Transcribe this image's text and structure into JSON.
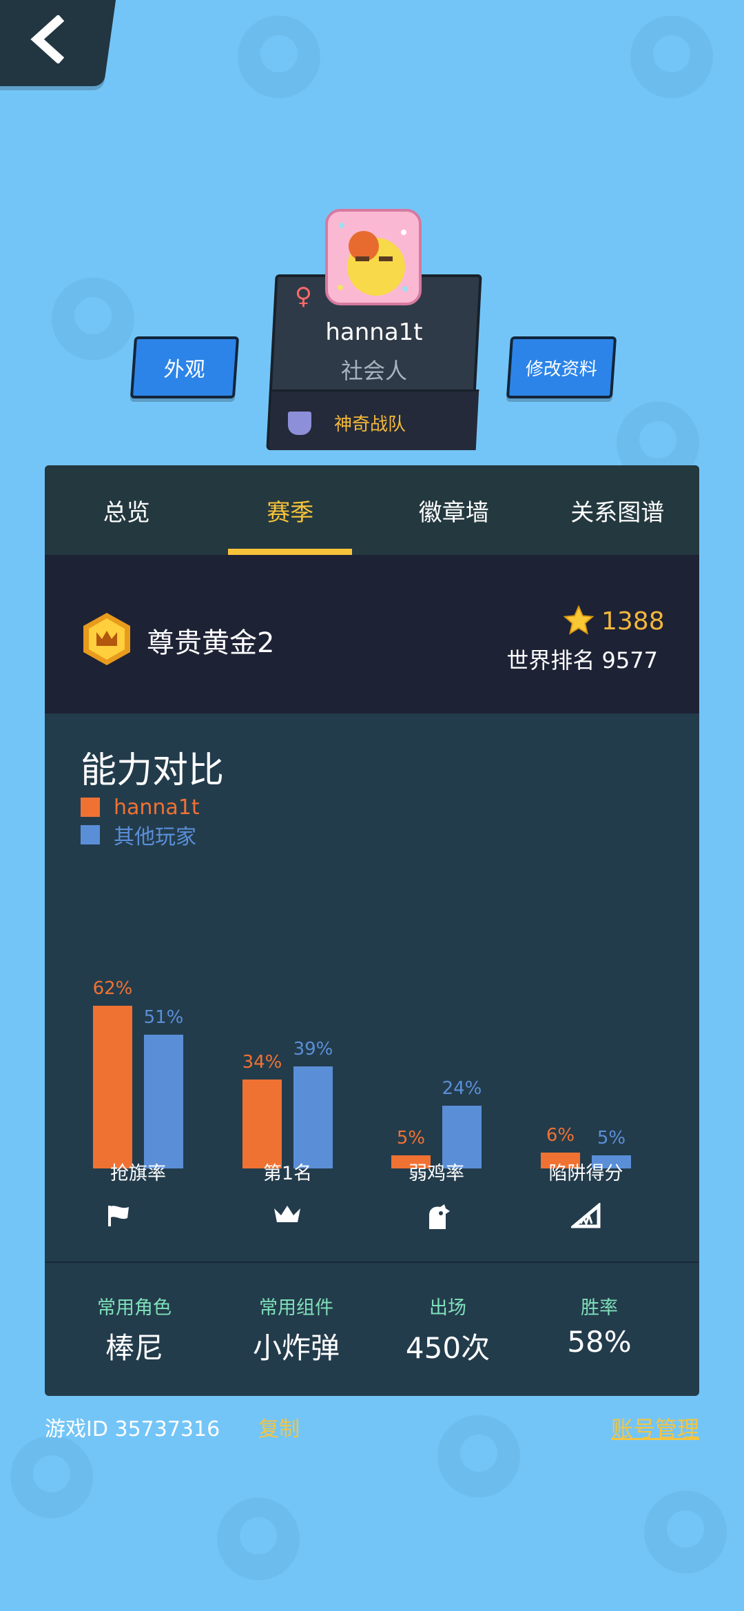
{
  "profile": {
    "gender_symbol": "♀",
    "username": "hanna1t",
    "title": "社会人",
    "team": "神奇战队"
  },
  "buttons": {
    "appearance": "外观",
    "edit_profile": "修改资料"
  },
  "tabs": [
    {
      "label": "总览"
    },
    {
      "label": "赛季",
      "active": true
    },
    {
      "label": "徽章墙"
    },
    {
      "label": "关系图谱"
    }
  ],
  "rank": {
    "tier": "尊贵黄金2",
    "stars": "1388",
    "world_rank": "世界排名 9577"
  },
  "ability": {
    "title": "能力对比",
    "legend_player": "hanna1t",
    "legend_others": "其他玩家"
  },
  "colors": {
    "player": "#f07233",
    "others": "#5a8fd8",
    "accent": "#f7c339",
    "panel": "#233c4c"
  },
  "chart_data": {
    "type": "bar",
    "categories": [
      "抢旗率",
      "第1名",
      "弱鸡率",
      "陷阱得分"
    ],
    "series": [
      {
        "name": "hanna1t",
        "values": [
          62,
          34,
          5,
          6
        ],
        "labels": [
          "62%",
          "34%",
          "5%",
          "6%"
        ]
      },
      {
        "name": "其他玩家",
        "values": [
          51,
          39,
          24,
          5
        ],
        "labels": [
          "51%",
          "39%",
          "24%",
          "5%"
        ]
      }
    ],
    "icons": [
      "flag-icon",
      "crown-icon",
      "chicken-icon",
      "trap-icon"
    ]
  },
  "stats": [
    {
      "label": "常用角色",
      "value": "棒尼"
    },
    {
      "label": "常用组件",
      "value": "小炸弹"
    },
    {
      "label": "出场",
      "value": "450次"
    },
    {
      "label": "胜率",
      "value": "58%"
    }
  ],
  "footer": {
    "game_id": "游戏ID 35737316",
    "copy": "复制",
    "account": "账号管理"
  }
}
